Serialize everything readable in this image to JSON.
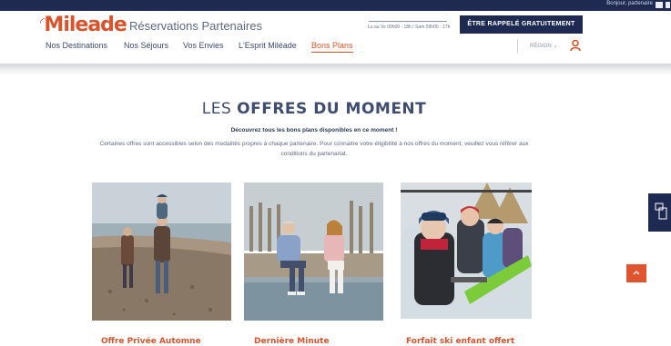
{
  "topbar": {
    "greeting": "Bonjour, partenaire"
  },
  "header": {
    "logo_text": "Mileade",
    "tagline": "Réservations Partenaires",
    "phone_text": "Lu au Ve 09h00 - 18h / Sam 09h00 - 17h",
    "cta_label": "ÊTRE RAPPELÉ GRATUITEMENT",
    "region_label": "RÉGION",
    "brand_color": "#d9542c",
    "navy_color": "#1f2a52"
  },
  "nav": {
    "items": [
      {
        "label": "Nos Destinations",
        "active": false
      },
      {
        "label": "Nos Séjours",
        "active": false
      },
      {
        "label": "Vos Envies",
        "active": false
      },
      {
        "label": "L'Esprit Miléade",
        "active": false
      },
      {
        "label": "Bons Plans",
        "active": true
      }
    ]
  },
  "hero": {
    "title_light": "LES ",
    "title_bold": "OFFRES DU MOMENT",
    "subtitle": "Découvrez tous les bons plans disponibles en ce moment !",
    "description": "Certaines offres sont accessibles selon des modalités propres à chaque partenaire. Pour connaitre votre éligibilité à nos offres du moment, veuillez vous référer aux conditions du partenariat."
  },
  "offers": [
    {
      "title": "Offre Privée Automne",
      "image_icon": "beach-family-photo"
    },
    {
      "title": "Dernière Minute",
      "image_icon": "lake-couple-photo"
    },
    {
      "title": "Forfait ski enfant offert",
      "image_icon": "ski-family-photo"
    }
  ]
}
